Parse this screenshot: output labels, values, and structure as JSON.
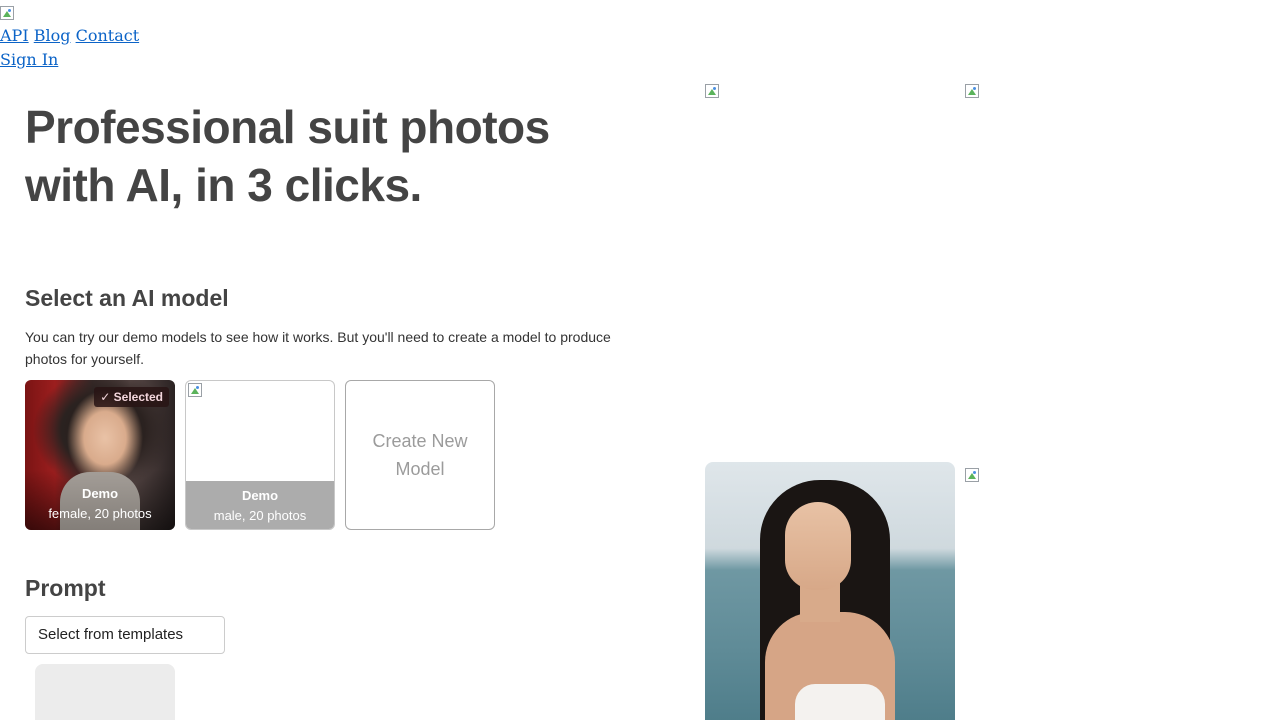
{
  "nav": {
    "links": [
      "API",
      "Blog",
      "Contact"
    ],
    "sign_in": "Sign In"
  },
  "hero": {
    "title_line1": "Professional suit photos",
    "title_line2": "with AI, in 3 clicks."
  },
  "model_section": {
    "title": "Select an AI model",
    "description": "You can try our demo models to see how it works. But you'll need to create a model to produce photos for yourself.",
    "cards": [
      {
        "name": "Demo",
        "meta": "female, 20 photos",
        "badge": "✓ Selected"
      },
      {
        "name": "Demo",
        "meta": "male, 20 photos"
      }
    ],
    "create_label": "Create New Model"
  },
  "prompt_section": {
    "title": "Prompt",
    "template_select": "Select from templates"
  }
}
